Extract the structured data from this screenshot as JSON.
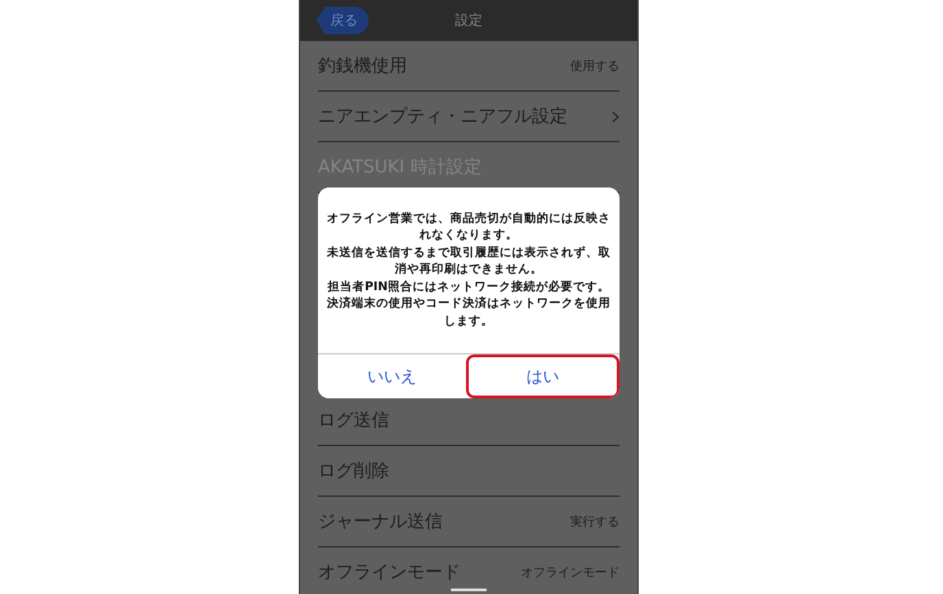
{
  "header": {
    "back_button": "戻る",
    "title": "設定"
  },
  "rows_above": [
    {
      "label": "釣銭機使用",
      "value": "使用する",
      "chevron": false,
      "disabled": false
    },
    {
      "label": "ニアエンプティ・ニアフル設定",
      "chevron": true,
      "disabled": false
    },
    {
      "label": "AKATSUKI 時計設定",
      "chevron": false,
      "disabled": true
    }
  ],
  "rows_below": [
    {
      "label": "ログ送信",
      "chevron": false,
      "disabled": false
    },
    {
      "label": "ログ削除",
      "chevron": false,
      "disabled": false
    },
    {
      "label": "ジャーナル送信",
      "value": "実行する",
      "chevron": false,
      "disabled": false
    },
    {
      "label": "オフラインモード",
      "value": "オフラインモード",
      "chevron": false,
      "disabled": false
    }
  ],
  "dialog": {
    "message": [
      "オフライン営業では、商品売切が自動的には反映されなくなります。",
      "未送信を送信するまで取引履歴には表示されず、取消や再印刷はできません。",
      "担当者PIN照合にはネットワーク接続が必要です。",
      "決済端末の使用やコード決済はネットワークを使用します。"
    ],
    "buttons": [
      {
        "label": "いいえ",
        "selected": false
      },
      {
        "label": "はい",
        "selected": true
      }
    ]
  }
}
